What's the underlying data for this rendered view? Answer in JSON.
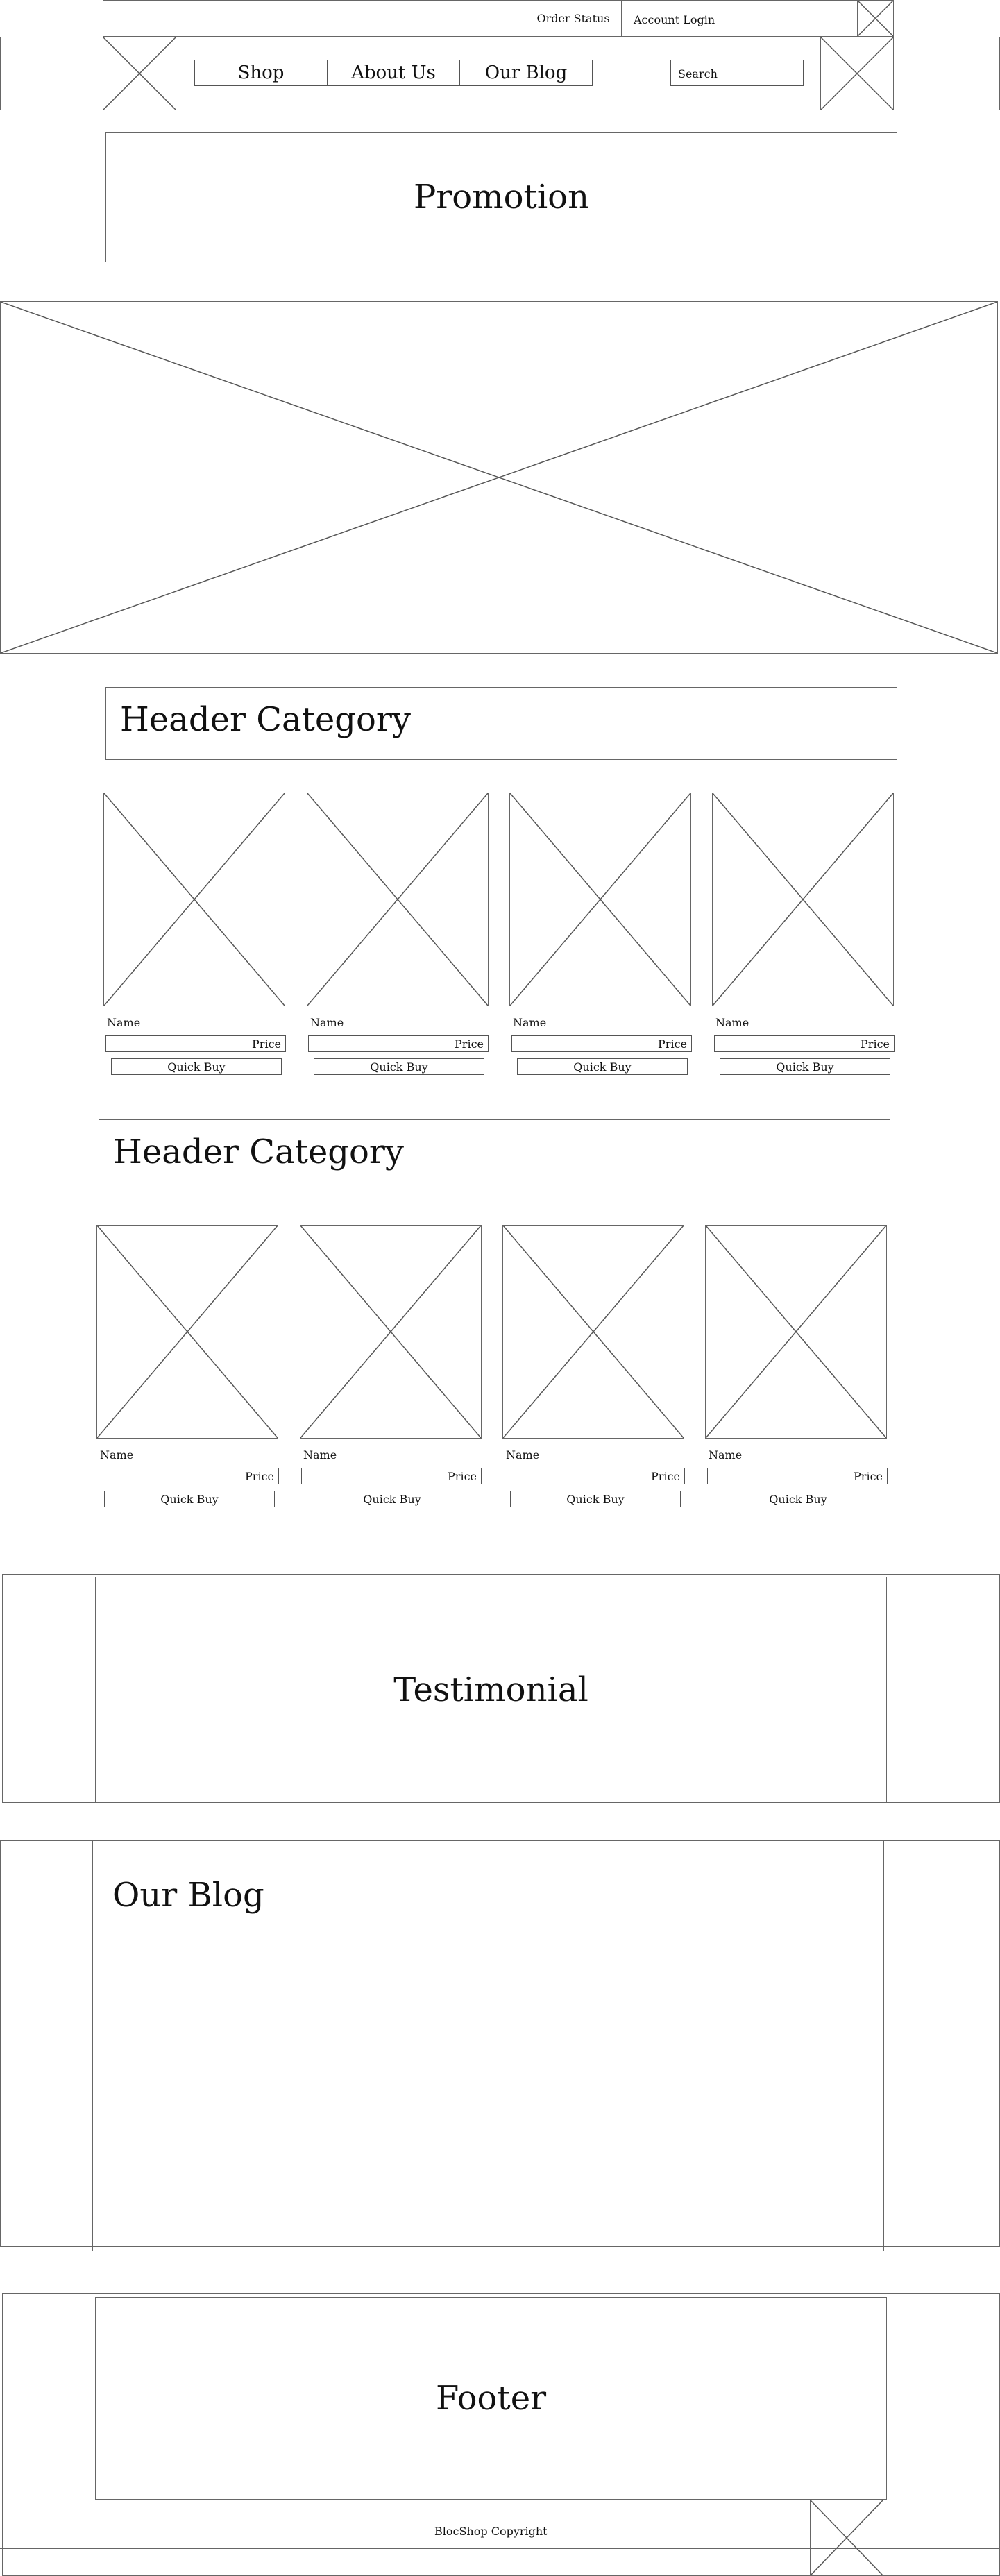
{
  "topbar": {
    "order_status": "Order Status",
    "account_login": "Account Login"
  },
  "nav": {
    "shop": "Shop",
    "about": "About Us",
    "blog": "Our Blog",
    "search_placeholder": "Search"
  },
  "promotion": {
    "title": "Promotion"
  },
  "categories": [
    {
      "header": "Header Category",
      "products": [
        {
          "name": "Name",
          "price": "Price",
          "cta": "Quick Buy"
        },
        {
          "name": "Name",
          "price": "Price",
          "cta": "Quick Buy"
        },
        {
          "name": "Name",
          "price": "Price",
          "cta": "Quick Buy"
        },
        {
          "name": "Name",
          "price": "Price",
          "cta": "Quick Buy"
        }
      ]
    },
    {
      "header": "Header Category",
      "products": [
        {
          "name": "Name",
          "price": "Price",
          "cta": "Quick Buy"
        },
        {
          "name": "Name",
          "price": "Price",
          "cta": "Quick Buy"
        },
        {
          "name": "Name",
          "price": "Price",
          "cta": "Quick Buy"
        },
        {
          "name": "Name",
          "price": "Price",
          "cta": "Quick Buy"
        }
      ]
    }
  ],
  "testimonial": {
    "title": "Testimonial"
  },
  "blog": {
    "title": "Our Blog"
  },
  "footer": {
    "title": "Footer",
    "copyright": "BlocShop Copyright"
  }
}
